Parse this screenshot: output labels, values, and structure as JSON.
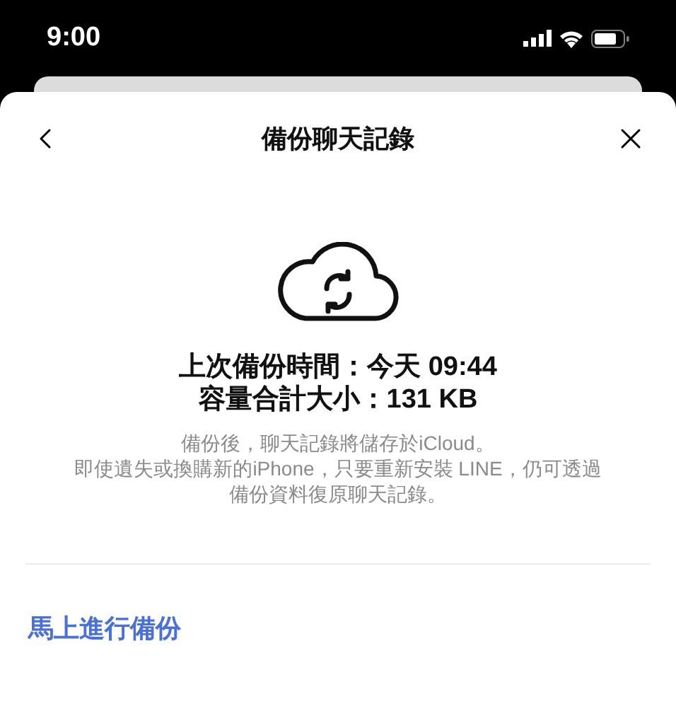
{
  "status_bar": {
    "time": "9:00"
  },
  "header": {
    "title": "備份聊天記錄"
  },
  "backup_info": {
    "last_backup": "上次備份時間：今天 09:44",
    "total_size": "容量合計大小：131 KB"
  },
  "description": [
    "備份後，聊天記錄將儲存於iCloud。",
    "即使遺失或換購新的iPhone，只要重新安裝 LINE，仍可透過",
    "備份資料復原聊天記錄。"
  ],
  "action": {
    "label": "馬上進行備份"
  }
}
